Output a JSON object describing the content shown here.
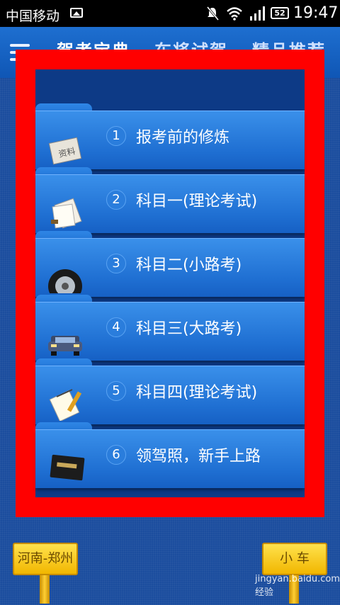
{
  "status_bar": {
    "carrier": "中国移动",
    "battery": "52",
    "time": "19:47"
  },
  "header": {
    "tabs": [
      {
        "label": "驾考宝典"
      },
      {
        "label": "车将试驾"
      },
      {
        "label": "精品推荐"
      }
    ]
  },
  "list": {
    "items": [
      {
        "number": "1",
        "label": "报考前的修炼",
        "icon": "document-icon"
      },
      {
        "number": "2",
        "label": "科目一(理论考试)",
        "icon": "papers-icon"
      },
      {
        "number": "3",
        "label": "科目二(小路考)",
        "icon": "tire-icon"
      },
      {
        "number": "4",
        "label": "科目三(大路考)",
        "icon": "car-icon"
      },
      {
        "number": "5",
        "label": "科目四(理论考试)",
        "icon": "notepad-icon"
      },
      {
        "number": "6",
        "label": "领驾照，新手上路",
        "icon": "license-icon"
      }
    ]
  },
  "bottom": {
    "region_sign": "河南-郑州",
    "vehicle_sign": "小 车"
  },
  "watermark": "jingyan.baidu.com 经验",
  "colors": {
    "highlight_frame": "#ff0000",
    "header_blue": "#1e6fd0",
    "sign_yellow": "#f1b600"
  }
}
